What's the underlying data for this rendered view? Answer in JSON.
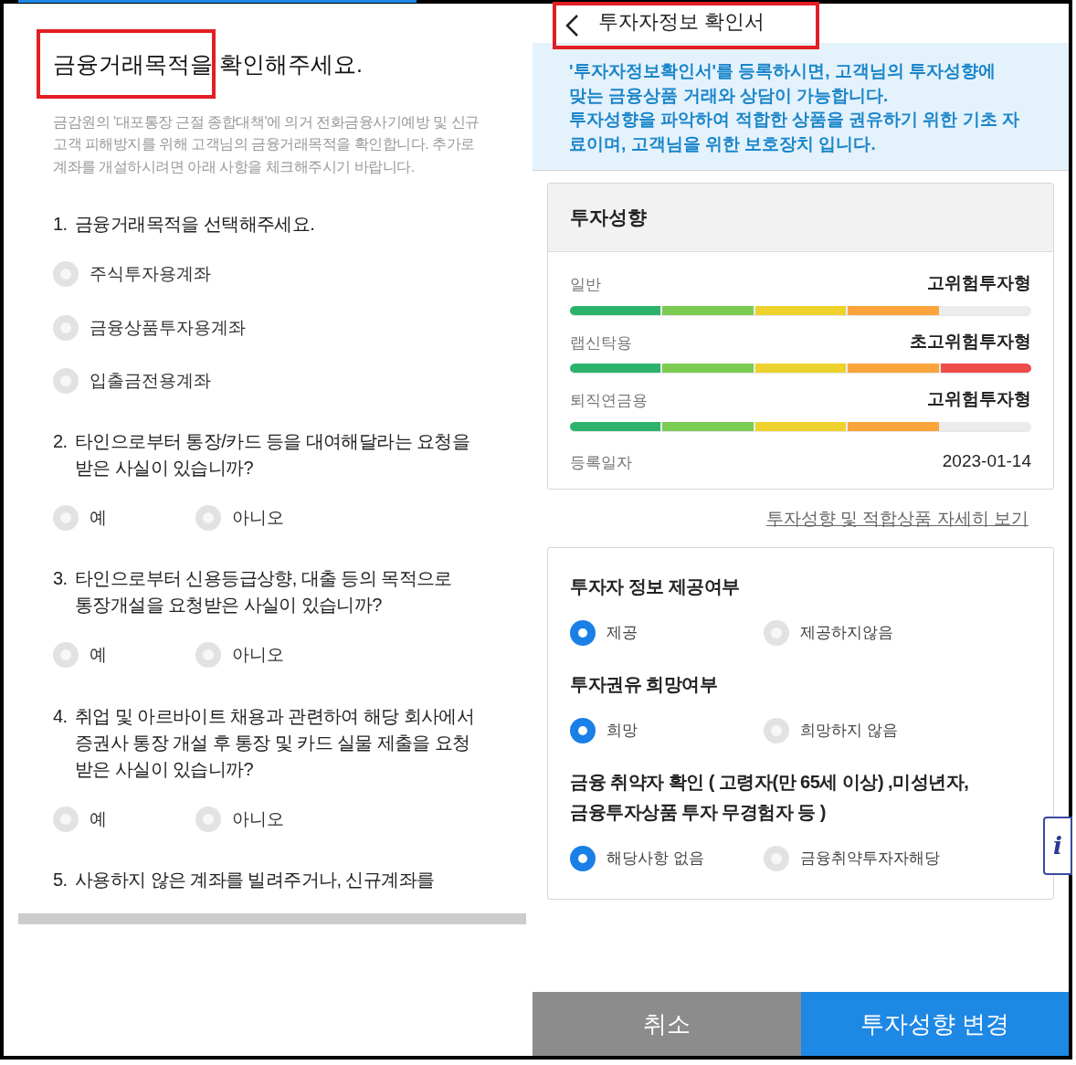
{
  "left": {
    "heading": "금융거래목적을 확인해주세요.",
    "description": "금감원의 '대포통장 근절 종합대책'에 의거 전화금융사기예방 및 신규고객 피해방지를 위해 고객님의 금융거래목적을 확인합니다. 추가로 계좌를 개설하시려면 아래 사항을 체크해주시기 바랍니다.",
    "questions": [
      {
        "kind": "list",
        "number": "1.",
        "lines": [
          "금융거래목적을 선택해주세요."
        ],
        "options": [
          {
            "label": "주식투자용계좌",
            "selected": false
          },
          {
            "label": "금융상품투자용계좌",
            "selected": false
          },
          {
            "label": "입출금전용계좌",
            "selected": false
          }
        ]
      },
      {
        "kind": "inline",
        "number": "2.",
        "lines": [
          "타인으로부터 통장/카드 등을 대여해달라는 요청을",
          "받은 사실이 있습니까?"
        ],
        "options": [
          {
            "label": "예",
            "selected": false
          },
          {
            "label": "아니오",
            "selected": false
          }
        ]
      },
      {
        "kind": "inline",
        "number": "3.",
        "lines": [
          "타인으로부터 신용등급상향, 대출 등의 목적으로",
          "통장개설을 요청받은 사실이 있습니까?"
        ],
        "options": [
          {
            "label": "예",
            "selected": false
          },
          {
            "label": "아니오",
            "selected": false
          }
        ]
      },
      {
        "kind": "inline",
        "number": "4.",
        "lines": [
          "취업 및 아르바이트 채용과 관련하여 해당 회사에서",
          "증권사 통장 개설 후 통장 및 카드 실물 제출을 요청",
          "받은 사실이 있습니까?"
        ],
        "options": [
          {
            "label": "예",
            "selected": false
          },
          {
            "label": "아니오",
            "selected": false
          }
        ]
      },
      {
        "kind": "cut",
        "number": "5.",
        "lines": [
          "사용하지 않은 계좌를 빌려주거나, 신규계좌를"
        ]
      }
    ]
  },
  "right": {
    "title": "투자자정보 확인서",
    "notice_lines": [
      "'투자자정보확인서'를 등록하시면, 고객님의 투자성향에",
      "맞는 금융상품 거래와 상담이 가능합니다.",
      "투자성향을 파악하여 적합한 상품을 권유하기 위한 기초 자",
      "료이며, 고객님을 위한 보호장치 입니다."
    ],
    "profile": {
      "title": "투자성향",
      "rows": [
        {
          "label": "일반",
          "value": "고위험투자형",
          "level": 0.8
        },
        {
          "label": "랩신탁용",
          "value": "초고위험투자형",
          "level": 1
        },
        {
          "label": "퇴직연금용",
          "value": "고위험투자형",
          "level": 0.8
        }
      ],
      "date_label": "등록일자",
      "date": "2023-01-14"
    },
    "detail_link": "투자성향 및 적합상품 자세히 보기",
    "consent": [
      {
        "title_lines": [
          "투자자 정보 제공여부"
        ],
        "options": [
          {
            "label": "제공",
            "selected": true
          },
          {
            "label": "제공하지않음",
            "selected": false
          }
        ]
      },
      {
        "title_lines": [
          "투자권유 희망여부"
        ],
        "options": [
          {
            "label": "희망",
            "selected": true
          },
          {
            "label": "희망하지 않음",
            "selected": false
          }
        ]
      },
      {
        "title_lines": [
          "금융 취약자 확인 ( 고령자(만 65세 이상) ,미성년자,",
          "금융투자상품 투자 무경험자 등 )"
        ],
        "options": [
          {
            "label": "해당사항 없음",
            "selected": true
          },
          {
            "label": "금융취약투자자해당",
            "selected": false
          }
        ]
      }
    ],
    "info_tab": "i",
    "buttons": [
      {
        "kind": "cancel",
        "label": "취소"
      },
      {
        "kind": "primary",
        "label": "투자성향 변경"
      }
    ]
  }
}
